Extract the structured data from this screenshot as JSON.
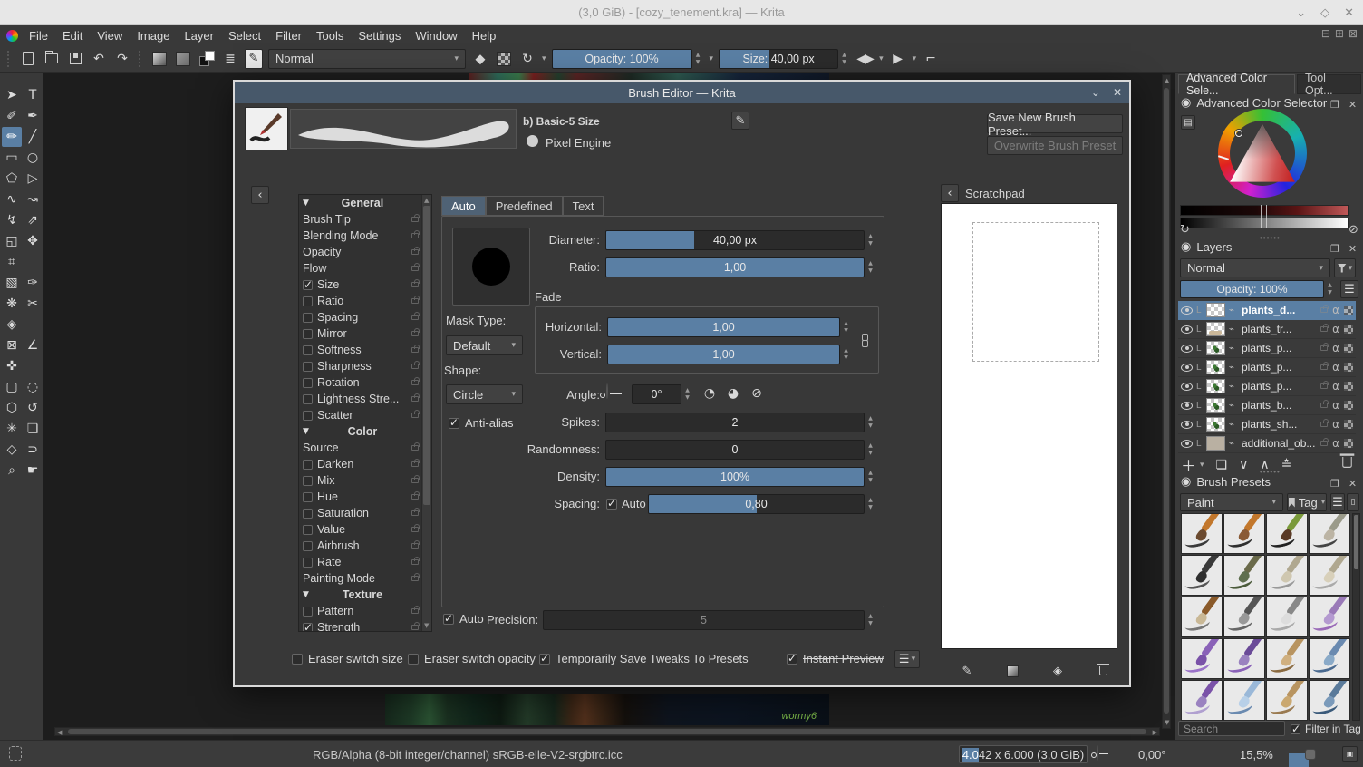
{
  "colors": {
    "accent": "#5a7fa4",
    "dialog_titlebar": "#47586a",
    "canvas_bg": "#1d1d1d"
  },
  "window": {
    "title": "(3,0 GiB) - [cozy_tenement.kra] — Krita"
  },
  "menubar": {
    "items": [
      {
        "label": "File"
      },
      {
        "label": "Edit"
      },
      {
        "label": "View"
      },
      {
        "label": "Image"
      },
      {
        "label": "Layer"
      },
      {
        "label": "Select"
      },
      {
        "label": "Filter"
      },
      {
        "label": "Tools"
      },
      {
        "label": "Settings"
      },
      {
        "label": "Window"
      },
      {
        "label": "Help"
      }
    ]
  },
  "toolbar": {
    "blend_mode": "Normal",
    "opacity": "Opacity: 100%",
    "size": "Size: 40,00 px"
  },
  "toolbox": {
    "tools": [
      {
        "n": "transform-select-tool",
        "g": "➤",
        "cls": ""
      },
      {
        "n": "text-tool",
        "g": "T",
        "cls": ""
      },
      {
        "n": "edit-shapes-tool",
        "g": "✐",
        "cls": ""
      },
      {
        "n": "calligraphy-tool",
        "g": "✒",
        "cls": ""
      },
      {
        "n": "freehand-brush-tool",
        "g": "✏",
        "cls": "sel"
      },
      {
        "n": "line-tool",
        "g": "╱",
        "cls": ""
      },
      {
        "n": "rectangle-tool",
        "g": "▭",
        "cls": ""
      },
      {
        "n": "ellipse-tool",
        "g": "○",
        "cls": ""
      },
      {
        "n": "polygon-tool",
        "g": "⬠",
        "cls": ""
      },
      {
        "n": "polyline-tool",
        "g": "▷",
        "cls": ""
      },
      {
        "n": "bezier-curve-tool",
        "g": "∿",
        "cls": ""
      },
      {
        "n": "freehand-path-tool",
        "g": "↝",
        "cls": ""
      },
      {
        "n": "dynamic-brush-tool",
        "g": "↯",
        "cls": ""
      },
      {
        "n": "multibrush-tool",
        "g": "⇗",
        "cls": ""
      },
      {
        "n": "transform-tool",
        "g": "◱",
        "cls": ""
      },
      {
        "n": "move-tool",
        "g": "✥",
        "cls": ""
      },
      {
        "n": "crop-tool",
        "g": "⌗",
        "cls": ""
      },
      {
        "n": "",
        "g": "",
        "cls": ""
      },
      {
        "n": "gradient-tool",
        "g": "▧",
        "cls": ""
      },
      {
        "n": "color-sampler-tool",
        "g": "✑",
        "cls": ""
      },
      {
        "n": "pattern-tool",
        "g": "❋",
        "cls": ""
      },
      {
        "n": "smart-patch-tool",
        "g": "✂",
        "cls": ""
      },
      {
        "n": "fill-tool",
        "g": "◈",
        "cls": ""
      },
      {
        "n": "",
        "g": "",
        "cls": ""
      },
      {
        "n": "enclose-fill-tool",
        "g": "⊠",
        "cls": ""
      },
      {
        "n": "measure-tool",
        "g": "∠",
        "cls": ""
      },
      {
        "n": "reference-images-tool",
        "g": "✜",
        "cls": ""
      },
      {
        "n": "",
        "g": "",
        "cls": ""
      },
      {
        "n": "rect-select-tool",
        "g": "▢",
        "cls": ""
      },
      {
        "n": "ellipse-select-tool",
        "g": "◌",
        "cls": ""
      },
      {
        "n": "polygon-select-tool",
        "g": "⬡",
        "cls": ""
      },
      {
        "n": "freehand-select-tool",
        "g": "↺",
        "cls": ""
      },
      {
        "n": "magic-wand-select-tool",
        "g": "✳",
        "cls": ""
      },
      {
        "n": "similar-select-tool",
        "g": "❏",
        "cls": ""
      },
      {
        "n": "bezier-select-tool",
        "g": "◇",
        "cls": ""
      },
      {
        "n": "magnetic-select-tool",
        "g": "⊃",
        "cls": ""
      },
      {
        "n": "zoom-tool",
        "g": "⌕",
        "cls": ""
      },
      {
        "n": "pan-tool",
        "g": "☛",
        "cls": ""
      }
    ]
  },
  "dialog": {
    "title": "Brush Editor — Krita",
    "preset_name": "b) Basic-5 Size",
    "engine": "Pixel Engine",
    "save_button": "Save New Brush Preset...",
    "overwrite_button": "Overwrite Brush Preset",
    "tabs": [
      {
        "label": "Auto",
        "cls": "active"
      },
      {
        "label": "Predefined",
        "cls": ""
      },
      {
        "label": "Text",
        "cls": ""
      }
    ],
    "options": [
      {
        "label": "General",
        "cls": "header"
      },
      {
        "label": "Brush Tip",
        "cls": "plain"
      },
      {
        "label": "Blending Mode",
        "cls": "plain"
      },
      {
        "label": "Opacity",
        "cls": "plain"
      },
      {
        "label": "Flow",
        "cls": "plain"
      },
      {
        "label": "Size",
        "cls": "check on"
      },
      {
        "label": "Ratio",
        "cls": "check"
      },
      {
        "label": "Spacing",
        "cls": "check"
      },
      {
        "label": "Mirror",
        "cls": "check"
      },
      {
        "label": "Softness",
        "cls": "check"
      },
      {
        "label": "Sharpness",
        "cls": "check"
      },
      {
        "label": "Rotation",
        "cls": "check"
      },
      {
        "label": "Lightness Stre...",
        "cls": "check"
      },
      {
        "label": "Scatter",
        "cls": "check"
      },
      {
        "label": "Color",
        "cls": "header"
      },
      {
        "label": "Source",
        "cls": "plain"
      },
      {
        "label": "Darken",
        "cls": "check"
      },
      {
        "label": "Mix",
        "cls": "check"
      },
      {
        "label": "Hue",
        "cls": "check"
      },
      {
        "label": "Saturation",
        "cls": "check"
      },
      {
        "label": "Value",
        "cls": "check"
      },
      {
        "label": "Airbrush",
        "cls": "check"
      },
      {
        "label": "Rate",
        "cls": "check"
      },
      {
        "label": "Painting Mode",
        "cls": "plain"
      },
      {
        "label": "Texture",
        "cls": "header"
      },
      {
        "label": "Pattern",
        "cls": "check"
      },
      {
        "label": "Strength",
        "cls": "check on"
      }
    ],
    "fields": {
      "diameter_label": "Diameter:",
      "diameter_value": "40,00 px",
      "ratio_label": "Ratio:",
      "ratio_value": "1,00",
      "fade_label": "Fade",
      "horizontal_label": "Horizontal:",
      "horizontal_value": "1,00",
      "vertical_label": "Vertical:",
      "vertical_value": "1,00",
      "mask_type_label": "Mask Type:",
      "mask_type_value": "Default",
      "shape_label": "Shape:",
      "shape_value": "Circle",
      "angle_label": "Angle:",
      "angle_value": "0°",
      "antialias_label": "Anti-alias",
      "spikes_label": "Spikes:",
      "spikes_value": "2",
      "randomness_label": "Randomness:",
      "randomness_value": "0",
      "density_label": "Density:",
      "density_value": "100%",
      "spacing_label": "Spacing:",
      "spacing_auto_label": "Auto",
      "spacing_value": "0,80",
      "precision_auto_label": "Auto",
      "precision_label": "Precision:",
      "precision_value": "5"
    },
    "footer": {
      "eraser_size": "Eraser switch size",
      "eraser_opacity": "Eraser switch opacity",
      "tweaks": "Temporarily Save Tweaks To Presets",
      "instant_preview": "Instant Preview"
    },
    "scratchpad": {
      "title": "Scratchpad"
    }
  },
  "sidebar": {
    "tabs": {
      "color": "Advanced Color Sele...",
      "tool": "Tool Opt..."
    },
    "color_selector": {
      "title": "Advanced Color Selector"
    },
    "layers": {
      "title": "Layers",
      "blend_mode": "Normal",
      "opacity": "Opacity: 100%",
      "rows": [
        {
          "name": "plants_d...",
          "cls": "selected",
          "tcls": ""
        },
        {
          "name": "plants_tr...",
          "cls": "",
          "tcls": "beige"
        },
        {
          "name": "plants_p...",
          "cls": "",
          "tcls": "green"
        },
        {
          "name": "plants_p...",
          "cls": "",
          "tcls": "green"
        },
        {
          "name": "plants_p...",
          "cls": "",
          "tcls": "green"
        },
        {
          "name": "plants_b...",
          "cls": "",
          "tcls": "green"
        },
        {
          "name": "plants_sh...",
          "cls": "",
          "tcls": "green"
        },
        {
          "name": "additional_ob...",
          "cls": "group",
          "tcls": "img"
        }
      ]
    },
    "presets": {
      "title": "Brush Presets",
      "tag_filter": "Paint",
      "tag_button": "Tag",
      "search_placeholder": "Search",
      "filter_in_tag": "Filter in Tag",
      "thumbs": [
        {
          "handle": "#c2772c",
          "bristle": "#6b4a2f",
          "stroke": "#3a3a3a"
        },
        {
          "handle": "#c2772c",
          "bristle": "#8a5a35",
          "stroke": "#2f2f2f"
        },
        {
          "handle": "#7a9a3a",
          "bristle": "#5a3a25",
          "stroke": "#222222"
        },
        {
          "handle": "#9a9a8a",
          "bristle": "#bcb4a4",
          "stroke": "#444444"
        },
        {
          "handle": "#3a3a3a",
          "bristle": "#2f2f2f",
          "stroke": "#555555"
        },
        {
          "handle": "#6a6a4a",
          "bristle": "#5f6f4f",
          "stroke": "#4a5a3a"
        },
        {
          "handle": "#b0a890",
          "bristle": "#cfc7b0",
          "stroke": "#999999"
        },
        {
          "handle": "#b0a890",
          "bristle": "#d8d0ba",
          "stroke": "#aaaaaa"
        },
        {
          "handle": "#8a5a2a",
          "bristle": "#c9b896",
          "stroke": "#777777"
        },
        {
          "handle": "#555555",
          "bristle": "#999999",
          "stroke": "#666666"
        },
        {
          "handle": "#888888",
          "bristle": "#dddddd",
          "stroke": "#aaaaaa"
        },
        {
          "handle": "#9a7ab8",
          "bristle": "#b49ad0",
          "stroke": "#9a6ab8"
        },
        {
          "handle": "#8a62b8",
          "bristle": "#7a52a8",
          "stroke": "#9a72c8"
        },
        {
          "handle": "#6a4a98",
          "bristle": "#9a82c0",
          "stroke": "#8a62b8"
        },
        {
          "handle": "#b89460",
          "bristle": "#d0b080",
          "stroke": "#8a6a40"
        },
        {
          "handle": "#6a8ab0",
          "bristle": "#8aaac8",
          "stroke": "#4a6a90"
        },
        {
          "handle": "#7a52a8",
          "bristle": "#9a82c0",
          "stroke": "#b0a0d0"
        },
        {
          "handle": "#9ab8d8",
          "bristle": "#b8d0e8",
          "stroke": "#6a8ab0"
        },
        {
          "handle": "#b89460",
          "bristle": "#caa870",
          "stroke": "#9a7a50"
        },
        {
          "handle": "#5a7a9a",
          "bristle": "#7a9aba",
          "stroke": "#3a5a7a"
        }
      ]
    }
  },
  "statusbar": {
    "color_info": "RGB/Alpha (8-bit integer/channel)  sRGB-elle-V2-srgbtrc.icc",
    "dims_selected": "4.0",
    "dims_rest": "42 x 6.000 (3,0 GiB)",
    "angle": "0,00°",
    "zoom": "15,5%"
  },
  "canvas": {
    "signature": "wormy6"
  }
}
